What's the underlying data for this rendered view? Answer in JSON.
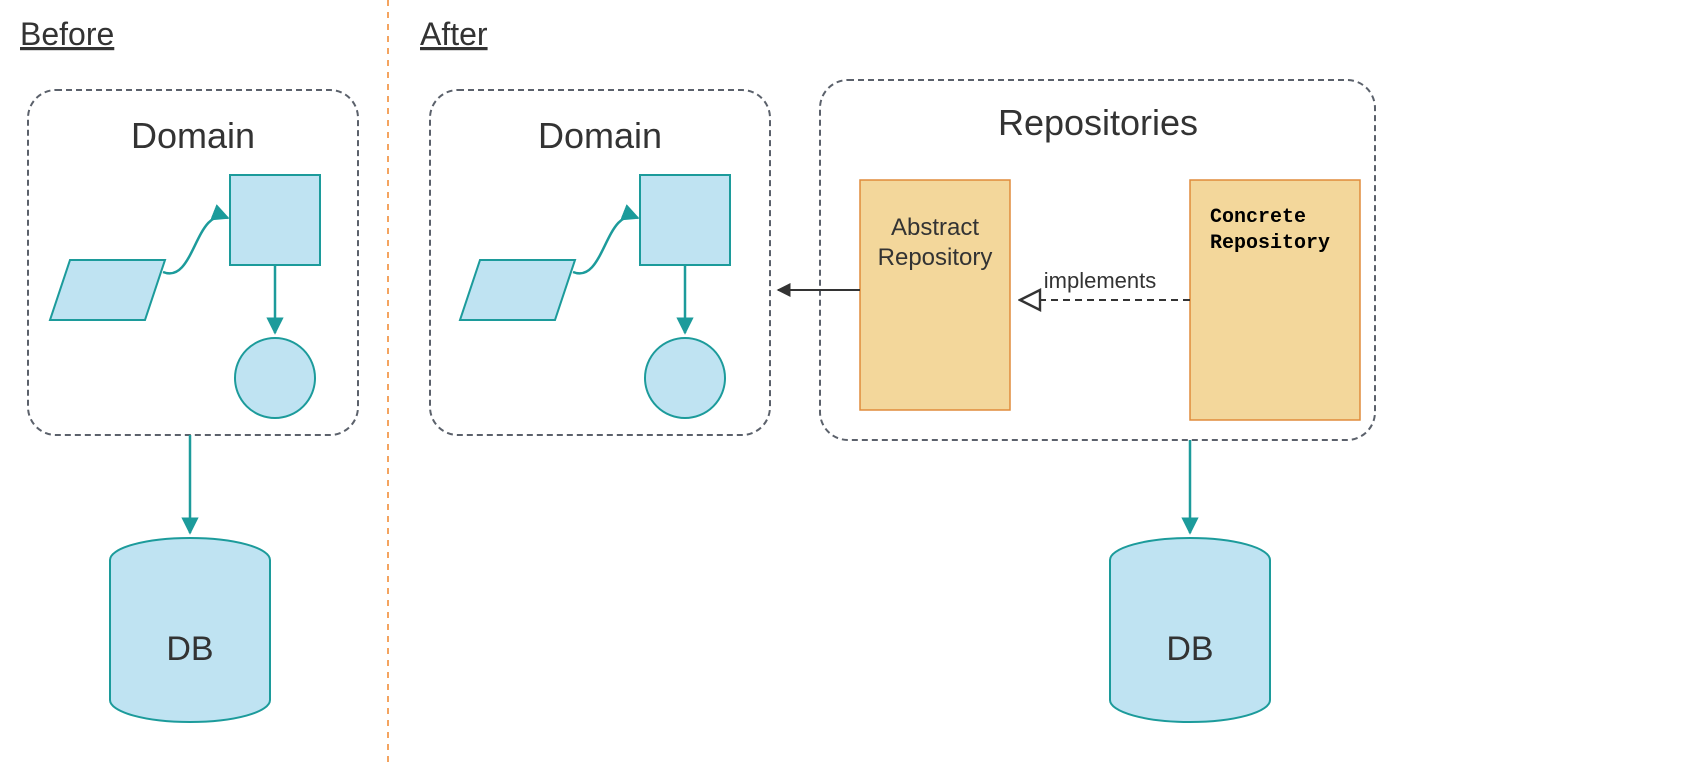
{
  "headings": {
    "before": "Before",
    "after": "After"
  },
  "panels": {
    "domain": "Domain",
    "repositories": "Repositories"
  },
  "repo_boxes": {
    "abstract_line1": "Abstract",
    "abstract_line2": "Repository",
    "concrete_line1": "Concrete",
    "concrete_line2": "Repository"
  },
  "labels": {
    "implements": "implements",
    "db": "DB"
  },
  "colors": {
    "panel_stroke": "#5b616b",
    "shape_fill": "#bfe3f2",
    "shape_stroke": "#1c9b9b",
    "divider": "#f4a460",
    "repo_fill": "#f3d79b",
    "repo_stroke": "#e08b3b",
    "arrow_dark": "#333333"
  }
}
